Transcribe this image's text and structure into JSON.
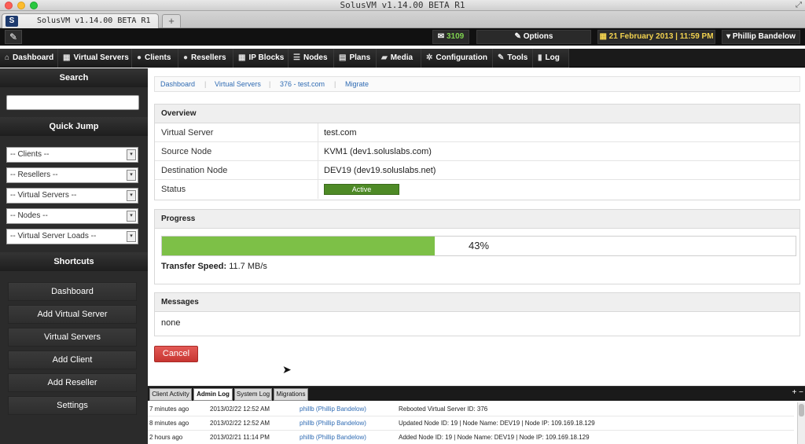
{
  "window": {
    "title": "SolusVM v1.14.00 BETA R1",
    "tab_label": "SolusVM v1.14.00 BETA R1",
    "tab_logo": "S",
    "new_tab": "+"
  },
  "topbar": {
    "messages_count": "3109",
    "options_label": "Options",
    "date_label": "21 February 2013 | 11:59 PM",
    "user_label": "Phillip Bandelow"
  },
  "nav": [
    {
      "label": "Dashboard",
      "icon": "home-icon",
      "glyph": "⌂"
    },
    {
      "label": "Virtual Servers",
      "icon": "grid-icon",
      "glyph": "▦"
    },
    {
      "label": "Clients",
      "icon": "user-icon",
      "glyph": "●"
    },
    {
      "label": "Resellers",
      "icon": "user-icon",
      "glyph": "●"
    },
    {
      "label": "IP Blocks",
      "icon": "grid-icon",
      "glyph": "▦"
    },
    {
      "label": "Nodes",
      "icon": "list-icon",
      "glyph": "☰"
    },
    {
      "label": "Plans",
      "icon": "doc-icon",
      "glyph": "▤"
    },
    {
      "label": "Media",
      "icon": "folder-icon",
      "glyph": "▰"
    },
    {
      "label": "Configuration",
      "icon": "gear-icon",
      "glyph": "✲"
    },
    {
      "label": "Tools",
      "icon": "wrench-icon",
      "glyph": "✎"
    },
    {
      "label": "Log",
      "icon": "file-icon",
      "glyph": "▮"
    }
  ],
  "sidebar": {
    "search_heading": "Search",
    "quick_jump_heading": "Quick Jump",
    "selects": [
      "-- Clients --",
      "-- Resellers --",
      "-- Virtual Servers --",
      "-- Nodes --",
      "-- Virtual Server Loads --"
    ],
    "shortcuts_heading": "Shortcuts",
    "shortcuts": [
      "Dashboard",
      "Add Virtual Server",
      "Virtual Servers",
      "Add Client",
      "Add Reseller",
      "Settings"
    ]
  },
  "breadcrumb": [
    "Dashboard",
    "Virtual Servers",
    "376 - test.com",
    "Migrate"
  ],
  "overview": {
    "heading": "Overview",
    "rows": [
      {
        "label": "Virtual Server",
        "value": "test.com"
      },
      {
        "label": "Source Node",
        "value": "KVM1 (dev1.soluslabs.com)"
      },
      {
        "label": "Destination Node",
        "value": "DEV19 (dev19.soluslabs.net)"
      },
      {
        "label": "Status",
        "value": "Active"
      }
    ]
  },
  "progress": {
    "heading": "Progress",
    "percent": 43,
    "percent_label": "43%",
    "speed_label": "Transfer Speed:",
    "speed_value": "11.7 MB/s"
  },
  "messages": {
    "heading": "Messages",
    "body": "none"
  },
  "cancel_label": "Cancel",
  "log": {
    "tabs": [
      "Client Activity",
      "Admin Log",
      "System Log",
      "Migrations"
    ],
    "active_tab": 1,
    "rows": [
      {
        "ago": "7 minutes ago",
        "date": "2013/02/22 12:52 AM",
        "user": "phillb (Phillip Bandelow)",
        "msg": "Rebooted Virtual Server ID: 376"
      },
      {
        "ago": "8 minutes ago",
        "date": "2013/02/22 12:52 AM",
        "user": "phillb (Phillip Bandelow)",
        "msg": "Updated Node ID: 19 | Node Name: DEV19 | Node IP: 109.169.18.129"
      },
      {
        "ago": "2 hours ago",
        "date": "2013/02/21 11:14 PM",
        "user": "phillb (Phillip Bandelow)",
        "msg": "Added Node ID: 19 | Node Name: DEV19 | Node IP: 109.169.18.129"
      }
    ]
  },
  "colors": {
    "accent_green": "#7dc047",
    "status_green": "#4e8a26",
    "cancel_red": "#c73531",
    "link_blue": "#2f6bb3"
  }
}
